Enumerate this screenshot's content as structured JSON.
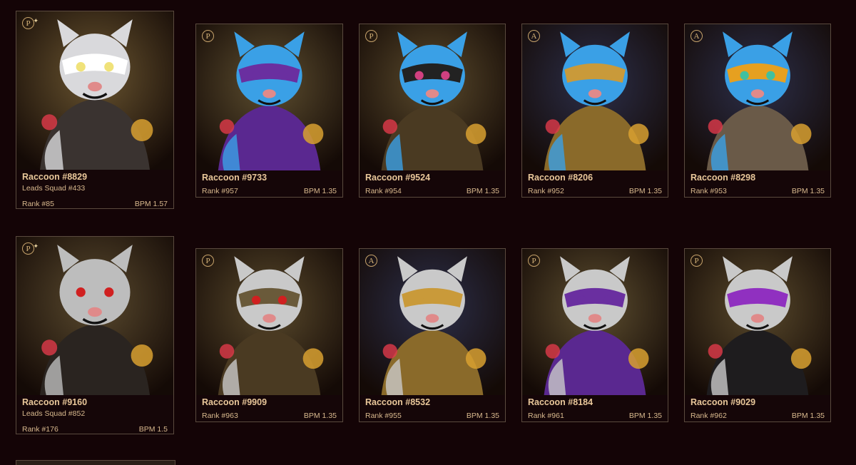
{
  "cards": [
    {
      "name": "Raccoon #8829",
      "squad": "Leads Squad #433",
      "rank": "Rank #85",
      "bpm": "BPM 1.57",
      "badge": "P",
      "star": true,
      "bg": "#6a5530",
      "mask": "#ffffff",
      "eye": "#f0e27a",
      "outfit": "#3a3330",
      "fur": "#d9d9dc"
    },
    {
      "name": "Raccoon #9733",
      "squad": "",
      "rank": "Rank #957",
      "bpm": "BPM 1.35",
      "badge": "P",
      "star": false,
      "bg": "#5e4f30",
      "mask": "#6a2fa0",
      "eye": "#6a2fa0",
      "outfit": "#5a2890",
      "fur": "#3aa0e6"
    },
    {
      "name": "Raccoon #9524",
      "squad": "",
      "rank": "Rank #954",
      "bpm": "BPM 1.35",
      "badge": "P",
      "star": false,
      "bg": "#5a4a2c",
      "mask": "#222222",
      "eye": "#d04080",
      "outfit": "#4a3a22",
      "fur": "#3aa0e6"
    },
    {
      "name": "Raccoon #8206",
      "squad": "",
      "rank": "Rank #952",
      "bpm": "BPM 1.35",
      "badge": "A",
      "star": false,
      "bg": "#2c2f4a",
      "mask": "#c99a3a",
      "eye": "#c99a3a",
      "outfit": "#8a6a2a",
      "fur": "#3aa0e6"
    },
    {
      "name": "Raccoon #8298",
      "squad": "",
      "rank": "Rank #953",
      "bpm": "BPM 1.35",
      "badge": "A",
      "star": false,
      "bg": "#2c2f4a",
      "mask": "#e6a020",
      "eye": "#40c0a0",
      "outfit": "#6a5a48",
      "fur": "#3aa0e6"
    },
    {
      "name": "Raccoon #9160",
      "squad": "Leads Squad #852",
      "rank": "Rank #176",
      "bpm": "BPM 1.5",
      "badge": "P",
      "star": true,
      "bg": "#5a4a2e",
      "mask": "#bdbdbd",
      "eye": "#d02020",
      "outfit": "#2a2420",
      "fur": "#bdbdbd"
    },
    {
      "name": "Raccoon #9909",
      "squad": "",
      "rank": "Rank #963",
      "bpm": "BPM 1.35",
      "badge": "P",
      "star": false,
      "bg": "#5a4a2c",
      "mask": "#6a5a3a",
      "eye": "#d02020",
      "outfit": "#4a3a22",
      "fur": "#c9c9c9"
    },
    {
      "name": "Raccoon #8532",
      "squad": "",
      "rank": "Rank #955",
      "bpm": "BPM 1.35",
      "badge": "A",
      "star": false,
      "bg": "#2c2f4a",
      "mask": "#c99a3a",
      "eye": "#c99a3a",
      "outfit": "#8a6a2a",
      "fur": "#c9c9c9"
    },
    {
      "name": "Raccoon #8184",
      "squad": "",
      "rank": "Rank #961",
      "bpm": "BPM 1.35",
      "badge": "P",
      "star": false,
      "bg": "#5e4f30",
      "mask": "#6a2fa0",
      "eye": "#6a2fa0",
      "outfit": "#5a2890",
      "fur": "#c9c9c9"
    },
    {
      "name": "Raccoon #9029",
      "squad": "",
      "rank": "Rank #962",
      "bpm": "BPM 1.35",
      "badge": "P",
      "star": false,
      "bg": "#5a4a2c",
      "mask": "#9030c0",
      "eye": "#9030c0",
      "outfit": "#1e1c1e",
      "fur": "#c9c9c9"
    }
  ]
}
